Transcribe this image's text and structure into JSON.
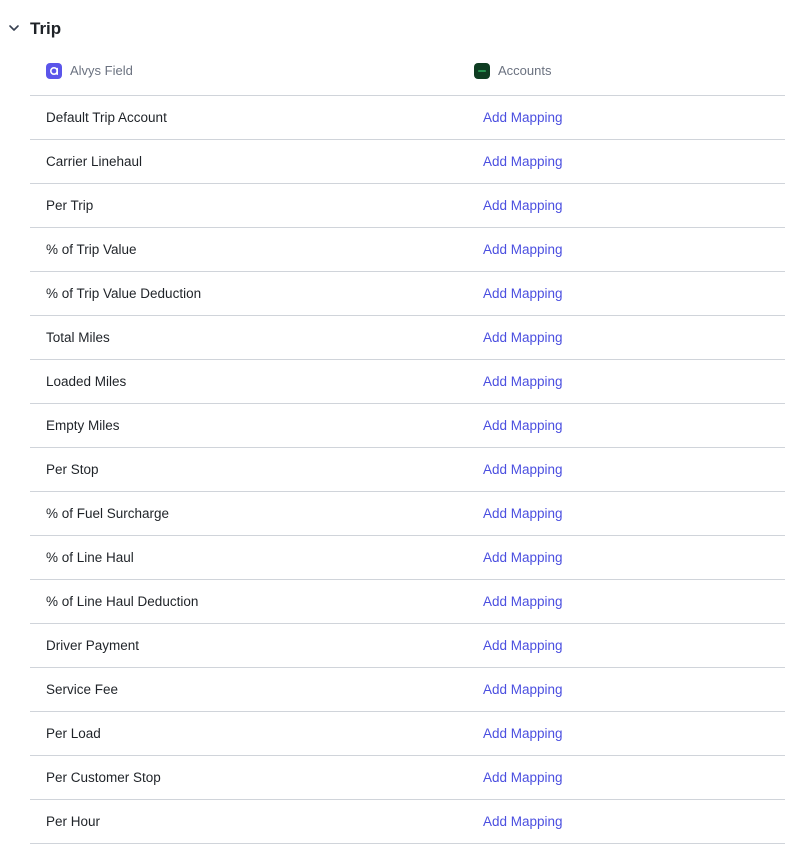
{
  "section": {
    "title": "Trip",
    "toggle_icon": "chevron-down-icon"
  },
  "columns": {
    "left": {
      "label": "Alvys Field",
      "icon": "alvys-logo-icon",
      "icon_color": "#5b55ea"
    },
    "right": {
      "label": "Accounts",
      "icon": "accounts-logo-icon",
      "icon_color": "#0f3d22"
    }
  },
  "link_color": "#4b4fe0",
  "rows": [
    {
      "field": "Default Trip Account",
      "action": "Add Mapping"
    },
    {
      "field": "Carrier Linehaul",
      "action": "Add Mapping"
    },
    {
      "field": "Per Trip",
      "action": "Add Mapping"
    },
    {
      "field": "% of Trip Value",
      "action": "Add Mapping"
    },
    {
      "field": "% of Trip Value Deduction",
      "action": "Add Mapping"
    },
    {
      "field": "Total Miles",
      "action": "Add Mapping"
    },
    {
      "field": "Loaded Miles",
      "action": "Add Mapping"
    },
    {
      "field": "Empty Miles",
      "action": "Add Mapping"
    },
    {
      "field": "Per Stop",
      "action": "Add Mapping"
    },
    {
      "field": "% of Fuel Surcharge",
      "action": "Add Mapping"
    },
    {
      "field": "% of Line Haul",
      "action": "Add Mapping"
    },
    {
      "field": "% of Line Haul Deduction",
      "action": "Add Mapping"
    },
    {
      "field": "Driver Payment",
      "action": "Add Mapping"
    },
    {
      "field": "Service Fee",
      "action": "Add Mapping"
    },
    {
      "field": "Per Load",
      "action": "Add Mapping"
    },
    {
      "field": "Per Customer Stop",
      "action": "Add Mapping"
    },
    {
      "field": "Per Hour",
      "action": "Add Mapping"
    }
  ]
}
